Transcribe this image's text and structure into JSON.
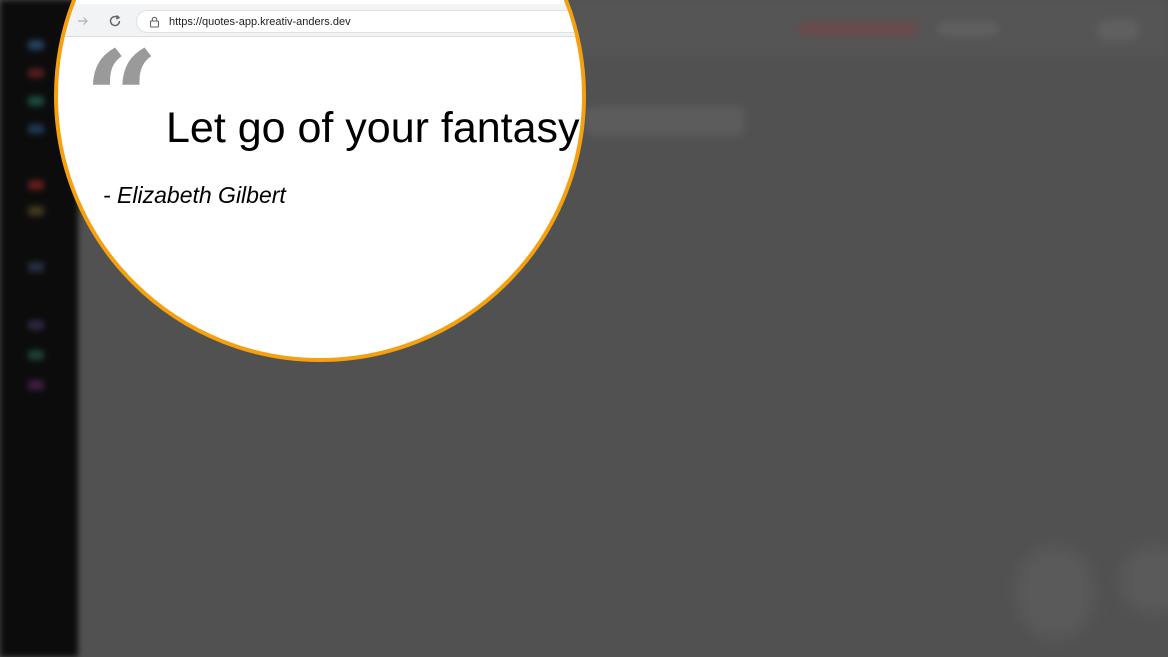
{
  "browser": {
    "url": "https://quotes-app.kreativ-anders.dev",
    "back_icon": "arrow-right-icon",
    "reload_icon": "reload-icon",
    "lock_icon": "lock-icon"
  },
  "quote": {
    "mark": "“",
    "text": "Let go of your fantasy",
    "author": "- Elizabeth Gilbert"
  },
  "colors": {
    "lens_border": "#f5a10f",
    "background_overlay": "#515151",
    "quote_mark": "#9a9a9a"
  }
}
